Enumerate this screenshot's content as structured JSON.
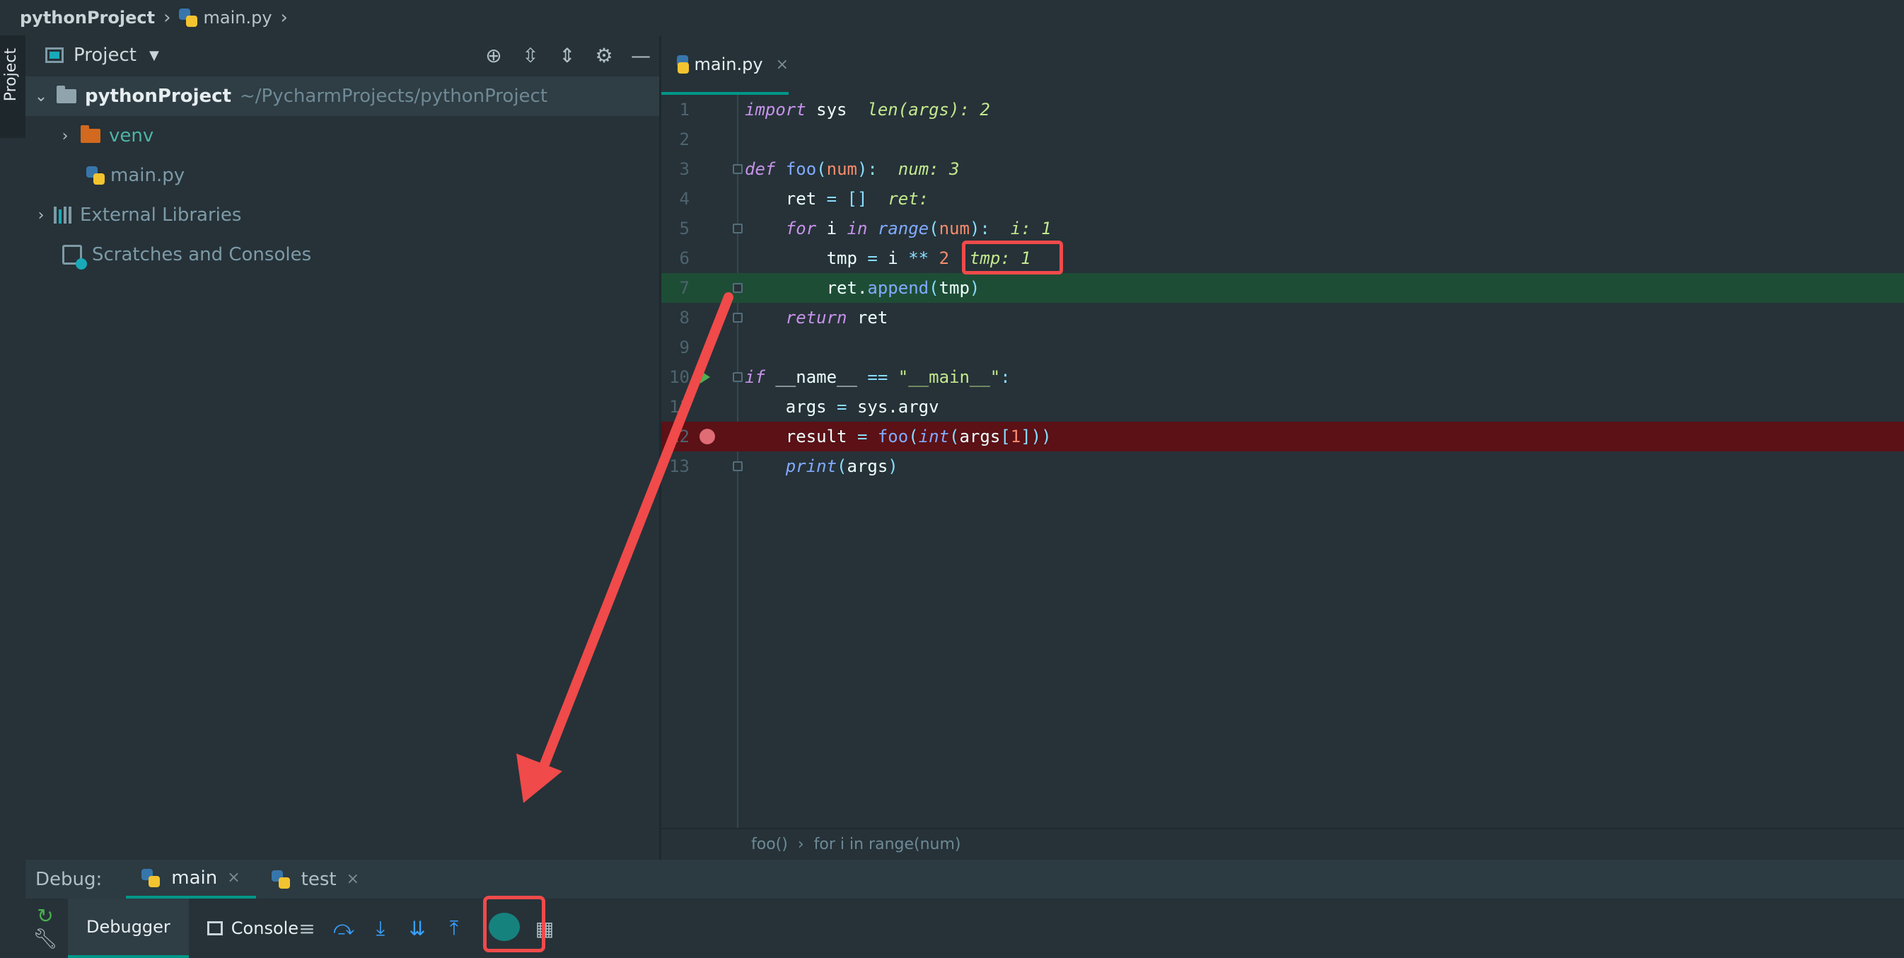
{
  "breadcrumb": {
    "project": "pythonProject",
    "file": "main.py",
    "separator": ">"
  },
  "side_strip": {
    "label": "Project"
  },
  "project_panel": {
    "title": "Project",
    "tree": [
      {
        "name": "pythonProject",
        "path": "~/PycharmProjects/pythonProject"
      },
      {
        "name": "venv"
      },
      {
        "name": "main.py"
      },
      {
        "name": "External Libraries"
      },
      {
        "name": "Scratches and Consoles"
      }
    ]
  },
  "editor": {
    "tab": "main.py",
    "line_numbers": [
      "1",
      "2",
      "3",
      "4",
      "5",
      "6",
      "7",
      "8",
      "9",
      "10",
      "11",
      "12",
      "13"
    ],
    "hints": {
      "line1": "len(args): 2",
      "line3": "num: 3",
      "line4": "ret:",
      "line5": "i: 1",
      "line6": "tmp: 1"
    },
    "breadcrumb": {
      "fn": "foo()",
      "scope": "for i in range(num)"
    }
  },
  "debug": {
    "label": "Debug:",
    "tabs": [
      {
        "name": "main"
      },
      {
        "name": "test"
      }
    ],
    "subtabs": {
      "debugger": "Debugger",
      "console": "Console"
    }
  },
  "colors": {
    "background": "#263238",
    "accent": "#009688",
    "annotation": "#f04a4a",
    "breakpoint_line": "#5b1116",
    "exec_line": "#1e4d36"
  }
}
